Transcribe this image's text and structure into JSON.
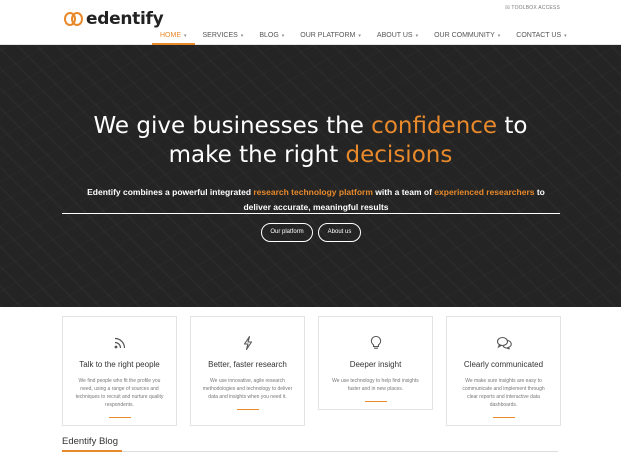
{
  "header": {
    "logo_text": "edentify",
    "toolbox_label": "☒ TOOLBOX ACCESS",
    "nav": [
      {
        "label": "HOME",
        "active": true
      },
      {
        "label": "SERVICES"
      },
      {
        "label": "BLOG"
      },
      {
        "label": "OUR PLATFORM"
      },
      {
        "label": "ABOUT US"
      },
      {
        "label": "OUR COMMUNITY"
      },
      {
        "label": "CONTACT US"
      }
    ]
  },
  "hero": {
    "title_part1": "We give businesses the ",
    "title_highlight1": "confidence",
    "title_part2": " to",
    "title_part3": "make the right ",
    "title_highlight2": "decisions",
    "sub_part1": "Edentify combines a powerful integrated ",
    "sub_highlight1": "research technology platform",
    "sub_part2": " with a team of ",
    "sub_highlight2": "experienced researchers",
    "sub_part3": " to",
    "sub_line2": "deliver accurate, meaningful results",
    "button1": "Our platform",
    "button2": "About us"
  },
  "cards": [
    {
      "icon": "rss-icon",
      "title": "Talk to the right people",
      "desc": "We find people who fit the profile you need, using a range of sources and techniques to recruit and nurture quality respondents."
    },
    {
      "icon": "lightning-icon",
      "title": "Better, faster research",
      "desc": "We use innovative, agile research methodologies and technology to deliver data and insights when you need it."
    },
    {
      "icon": "lightbulb-icon",
      "title": "Deeper insight",
      "desc": "We use technology to help find insights faster and in new places."
    },
    {
      "icon": "chat-bubbles-icon",
      "title": "Clearly communicated",
      "desc": "We make sure insights are easy to communicate and implement through clear reports and interactive data dashboards."
    }
  ],
  "blog": {
    "title": "Edentify Blog"
  },
  "colors": {
    "accent": "#e8892b",
    "hero_bg": "#242424"
  }
}
